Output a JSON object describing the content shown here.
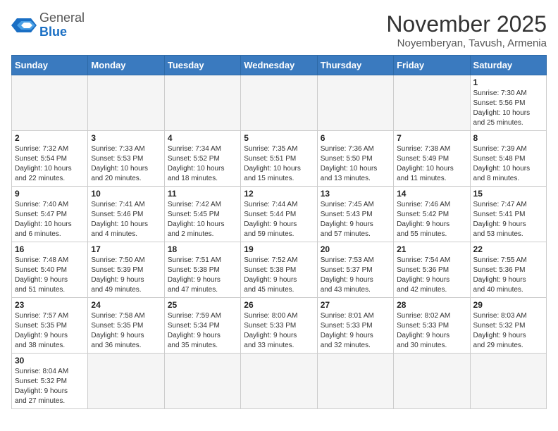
{
  "header": {
    "logo_general": "General",
    "logo_blue": "Blue",
    "title": "November 2025",
    "subtitle": "Noyemberyan, Tavush, Armenia"
  },
  "weekdays": [
    "Sunday",
    "Monday",
    "Tuesday",
    "Wednesday",
    "Thursday",
    "Friday",
    "Saturday"
  ],
  "days": [
    {
      "num": "",
      "info": ""
    },
    {
      "num": "",
      "info": ""
    },
    {
      "num": "",
      "info": ""
    },
    {
      "num": "",
      "info": ""
    },
    {
      "num": "",
      "info": ""
    },
    {
      "num": "",
      "info": ""
    },
    {
      "num": "1",
      "info": "Sunrise: 7:30 AM\nSunset: 5:56 PM\nDaylight: 10 hours\nand 25 minutes."
    },
    {
      "num": "2",
      "info": "Sunrise: 7:32 AM\nSunset: 5:54 PM\nDaylight: 10 hours\nand 22 minutes."
    },
    {
      "num": "3",
      "info": "Sunrise: 7:33 AM\nSunset: 5:53 PM\nDaylight: 10 hours\nand 20 minutes."
    },
    {
      "num": "4",
      "info": "Sunrise: 7:34 AM\nSunset: 5:52 PM\nDaylight: 10 hours\nand 18 minutes."
    },
    {
      "num": "5",
      "info": "Sunrise: 7:35 AM\nSunset: 5:51 PM\nDaylight: 10 hours\nand 15 minutes."
    },
    {
      "num": "6",
      "info": "Sunrise: 7:36 AM\nSunset: 5:50 PM\nDaylight: 10 hours\nand 13 minutes."
    },
    {
      "num": "7",
      "info": "Sunrise: 7:38 AM\nSunset: 5:49 PM\nDaylight: 10 hours\nand 11 minutes."
    },
    {
      "num": "8",
      "info": "Sunrise: 7:39 AM\nSunset: 5:48 PM\nDaylight: 10 hours\nand 8 minutes."
    },
    {
      "num": "9",
      "info": "Sunrise: 7:40 AM\nSunset: 5:47 PM\nDaylight: 10 hours\nand 6 minutes."
    },
    {
      "num": "10",
      "info": "Sunrise: 7:41 AM\nSunset: 5:46 PM\nDaylight: 10 hours\nand 4 minutes."
    },
    {
      "num": "11",
      "info": "Sunrise: 7:42 AM\nSunset: 5:45 PM\nDaylight: 10 hours\nand 2 minutes."
    },
    {
      "num": "12",
      "info": "Sunrise: 7:44 AM\nSunset: 5:44 PM\nDaylight: 9 hours\nand 59 minutes."
    },
    {
      "num": "13",
      "info": "Sunrise: 7:45 AM\nSunset: 5:43 PM\nDaylight: 9 hours\nand 57 minutes."
    },
    {
      "num": "14",
      "info": "Sunrise: 7:46 AM\nSunset: 5:42 PM\nDaylight: 9 hours\nand 55 minutes."
    },
    {
      "num": "15",
      "info": "Sunrise: 7:47 AM\nSunset: 5:41 PM\nDaylight: 9 hours\nand 53 minutes."
    },
    {
      "num": "16",
      "info": "Sunrise: 7:48 AM\nSunset: 5:40 PM\nDaylight: 9 hours\nand 51 minutes."
    },
    {
      "num": "17",
      "info": "Sunrise: 7:50 AM\nSunset: 5:39 PM\nDaylight: 9 hours\nand 49 minutes."
    },
    {
      "num": "18",
      "info": "Sunrise: 7:51 AM\nSunset: 5:38 PM\nDaylight: 9 hours\nand 47 minutes."
    },
    {
      "num": "19",
      "info": "Sunrise: 7:52 AM\nSunset: 5:38 PM\nDaylight: 9 hours\nand 45 minutes."
    },
    {
      "num": "20",
      "info": "Sunrise: 7:53 AM\nSunset: 5:37 PM\nDaylight: 9 hours\nand 43 minutes."
    },
    {
      "num": "21",
      "info": "Sunrise: 7:54 AM\nSunset: 5:36 PM\nDaylight: 9 hours\nand 42 minutes."
    },
    {
      "num": "22",
      "info": "Sunrise: 7:55 AM\nSunset: 5:36 PM\nDaylight: 9 hours\nand 40 minutes."
    },
    {
      "num": "23",
      "info": "Sunrise: 7:57 AM\nSunset: 5:35 PM\nDaylight: 9 hours\nand 38 minutes."
    },
    {
      "num": "24",
      "info": "Sunrise: 7:58 AM\nSunset: 5:35 PM\nDaylight: 9 hours\nand 36 minutes."
    },
    {
      "num": "25",
      "info": "Sunrise: 7:59 AM\nSunset: 5:34 PM\nDaylight: 9 hours\nand 35 minutes."
    },
    {
      "num": "26",
      "info": "Sunrise: 8:00 AM\nSunset: 5:33 PM\nDaylight: 9 hours\nand 33 minutes."
    },
    {
      "num": "27",
      "info": "Sunrise: 8:01 AM\nSunset: 5:33 PM\nDaylight: 9 hours\nand 32 minutes."
    },
    {
      "num": "28",
      "info": "Sunrise: 8:02 AM\nSunset: 5:33 PM\nDaylight: 9 hours\nand 30 minutes."
    },
    {
      "num": "29",
      "info": "Sunrise: 8:03 AM\nSunset: 5:32 PM\nDaylight: 9 hours\nand 29 minutes."
    },
    {
      "num": "30",
      "info": "Sunrise: 8:04 AM\nSunset: 5:32 PM\nDaylight: 9 hours\nand 27 minutes."
    },
    {
      "num": "",
      "info": ""
    },
    {
      "num": "",
      "info": ""
    },
    {
      "num": "",
      "info": ""
    },
    {
      "num": "",
      "info": ""
    },
    {
      "num": "",
      "info": ""
    },
    {
      "num": "",
      "info": ""
    }
  ]
}
